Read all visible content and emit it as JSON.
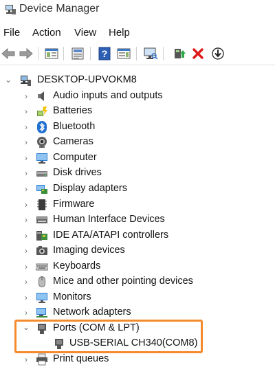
{
  "window": {
    "title": "Device Manager"
  },
  "menu": [
    {
      "label": "File"
    },
    {
      "label": "Action"
    },
    {
      "label": "View"
    },
    {
      "label": "Help"
    }
  ],
  "toolbar": {
    "buttons": [
      {
        "icon": "back-arrow-icon"
      },
      {
        "icon": "forward-arrow-icon"
      },
      {
        "icon": "show-hide-console-tree-icon"
      },
      {
        "icon": "properties-icon"
      },
      {
        "icon": "help-icon"
      },
      {
        "icon": "action-pane-icon"
      },
      {
        "icon": "scan-hardware-icon"
      },
      {
        "icon": "update-driver-icon"
      },
      {
        "icon": "uninstall-device-icon"
      },
      {
        "icon": "disable-device-icon"
      }
    ]
  },
  "tree": {
    "root": {
      "label": "DESKTOP-UPVOKM8",
      "expanded": true
    },
    "categories": [
      {
        "label": "Audio inputs and outputs",
        "icon": "speaker-icon"
      },
      {
        "label": "Batteries",
        "icon": "battery-icon"
      },
      {
        "label": "Bluetooth",
        "icon": "bluetooth-icon"
      },
      {
        "label": "Cameras",
        "icon": "camera-icon"
      },
      {
        "label": "Computer",
        "icon": "computer-icon"
      },
      {
        "label": "Disk drives",
        "icon": "disk-drive-icon"
      },
      {
        "label": "Display adapters",
        "icon": "display-adapter-icon"
      },
      {
        "label": "Firmware",
        "icon": "firmware-icon"
      },
      {
        "label": "Human Interface Devices",
        "icon": "hid-icon"
      },
      {
        "label": "IDE ATA/ATAPI controllers",
        "icon": "ide-controller-icon"
      },
      {
        "label": "Imaging devices",
        "icon": "imaging-device-icon"
      },
      {
        "label": "Keyboards",
        "icon": "keyboard-icon"
      },
      {
        "label": "Mice and other pointing devices",
        "icon": "mouse-icon"
      },
      {
        "label": "Monitors",
        "icon": "monitor-icon"
      },
      {
        "label": "Network adapters",
        "icon": "network-adapter-icon"
      },
      {
        "label": "Ports (COM & LPT)",
        "icon": "port-icon",
        "expanded": true
      },
      {
        "label": "Print queues",
        "icon": "printer-icon"
      }
    ],
    "ports_child": {
      "label": "USB-SERIAL CH340(COM8)",
      "icon": "port-icon"
    }
  },
  "colors": {
    "highlight": "#f58a2c"
  }
}
